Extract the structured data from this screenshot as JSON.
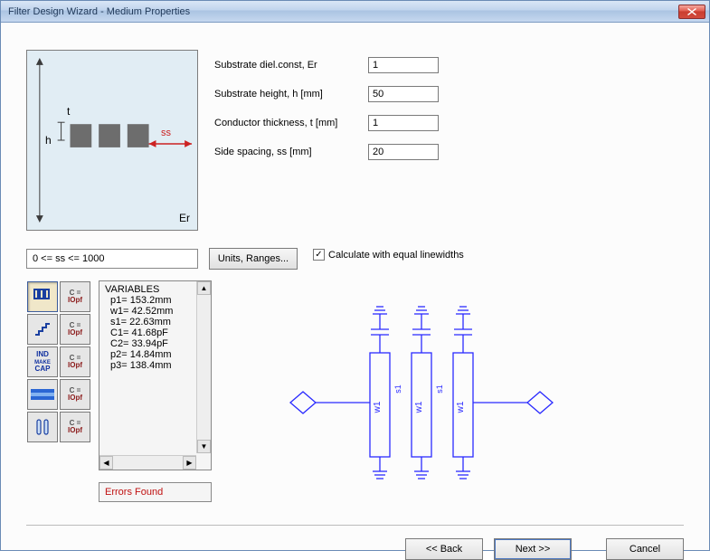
{
  "window": {
    "title": "Filter Design Wizard - Medium Properties"
  },
  "diagram": {
    "t_label": "t",
    "h_label": "h",
    "ss_label": "ss",
    "er_label": "Er"
  },
  "form": {
    "er": {
      "label": "Substrate diel.const, Er",
      "value": "1"
    },
    "h": {
      "label": "Substrate height, h [mm]",
      "value": "50"
    },
    "t": {
      "label": "Conductor thickness, t [mm]",
      "value": "1"
    },
    "ss": {
      "label": "Side spacing, ss [mm]",
      "value": "20"
    }
  },
  "range": {
    "text": "0 <= ss <= 1000"
  },
  "units_btn": {
    "label": "Units, Ranges..."
  },
  "calc_equal": {
    "label": "Calculate with equal linewidths",
    "checked": true
  },
  "palette": {
    "cap_label_top": "C =",
    "cap_label_bot": "IOpf",
    "ind_label": "IND\nCAP"
  },
  "variables": {
    "title": "VARIABLES",
    "lines": [
      "p1=   153.2mm",
      "w1=   42.52mm",
      "s1=   22.63mm",
      "C1=   41.68pF",
      "C2=   33.94pF",
      "p2=   14.84mm",
      "p3=   138.4mm"
    ]
  },
  "errors": {
    "text": "Errors Found"
  },
  "schematic_labels": {
    "w1": "w1",
    "s1": "s1"
  },
  "buttons": {
    "back": "<< Back",
    "next": "Next >>",
    "cancel": "Cancel"
  }
}
